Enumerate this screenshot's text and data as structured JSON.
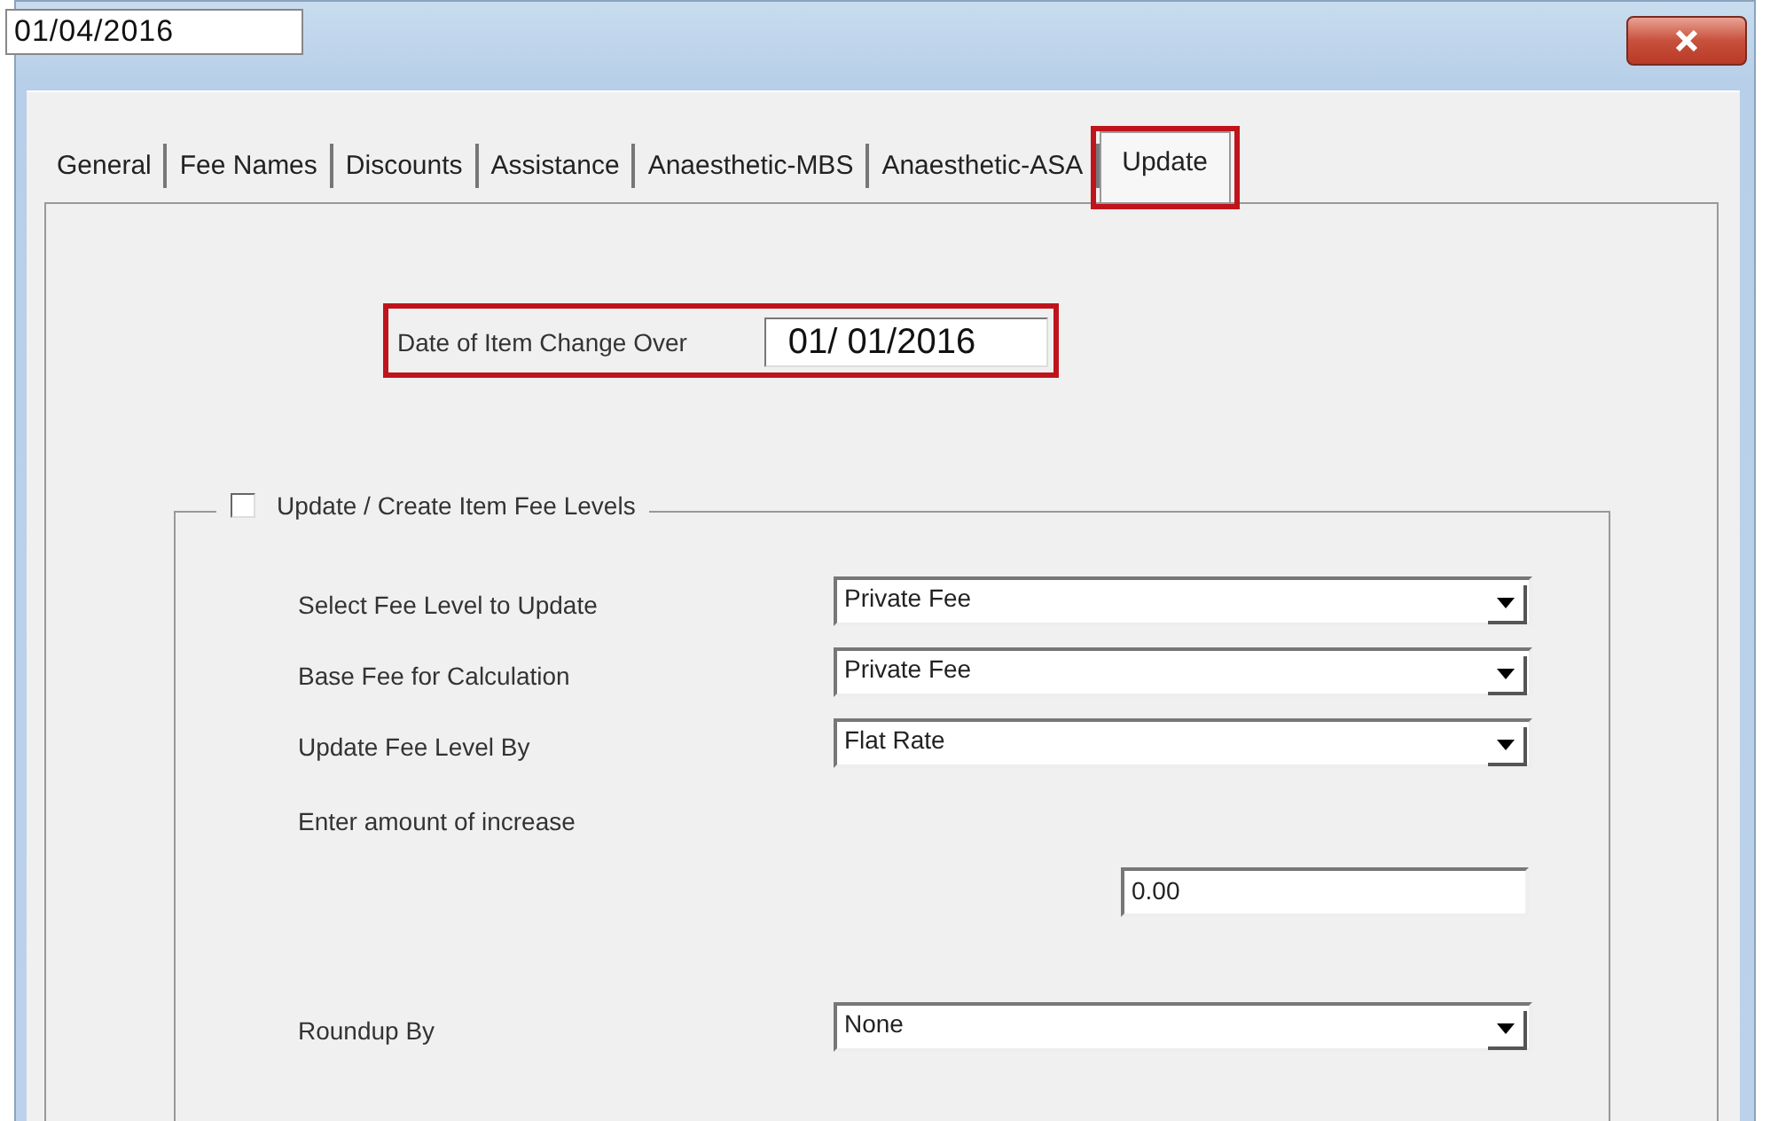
{
  "date_overlay": {
    "value": "01/04/2016"
  },
  "tabs": [
    {
      "label": "General",
      "selected": false,
      "highlighted": false
    },
    {
      "label": "Fee Names",
      "selected": false,
      "highlighted": false
    },
    {
      "label": "Discounts",
      "selected": false,
      "highlighted": false
    },
    {
      "label": "Assistance",
      "selected": false,
      "highlighted": false
    },
    {
      "label": "Anaesthetic-MBS",
      "selected": false,
      "highlighted": false
    },
    {
      "label": "Anaesthetic-ASA",
      "selected": false,
      "highlighted": false
    },
    {
      "label": "Update",
      "selected": true,
      "highlighted": true
    }
  ],
  "change_over": {
    "label": "Date of Item Change Over",
    "value": "01/ 01/2016",
    "highlighted": true
  },
  "fee_levels_group": {
    "label": "Update / Create Item Fee Levels",
    "checked": false,
    "fields": [
      {
        "kind": "dropdown",
        "label": "Select Fee Level to Update",
        "value": "Private Fee"
      },
      {
        "kind": "dropdown",
        "label": "Base Fee for Calculation",
        "value": "Private Fee"
      },
      {
        "kind": "dropdown",
        "label": "Update Fee Level By",
        "value": "Flat Rate"
      },
      {
        "kind": "amount",
        "label": "Enter amount of increase",
        "value": "0.00"
      },
      {
        "kind": "dropdown",
        "label": "Roundup By",
        "value": "None"
      }
    ]
  }
}
